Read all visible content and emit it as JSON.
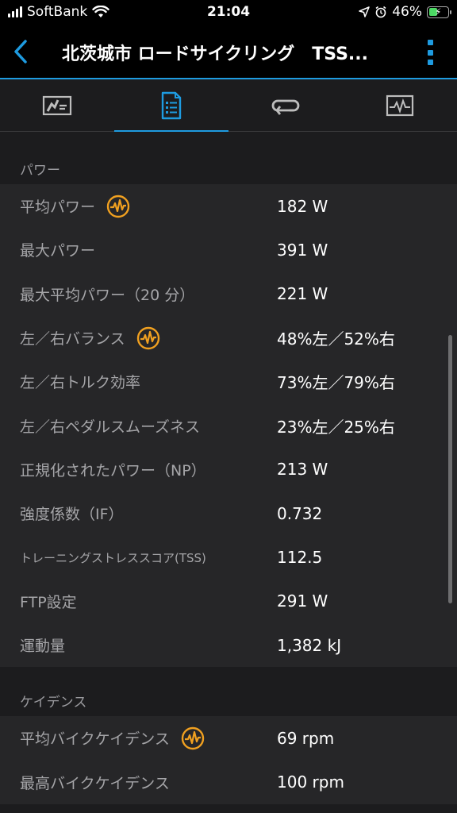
{
  "status_bar": {
    "carrier": "SoftBank",
    "time": "21:04",
    "battery_percent": "46%",
    "battery_level": 0.46
  },
  "header": {
    "title": "北茨城市 ロードサイクリング　TSS...",
    "accent_color": "#1e9be0"
  },
  "tabs": [
    {
      "icon": "speed-chart-icon",
      "active": false
    },
    {
      "icon": "document-list-icon",
      "active": true
    },
    {
      "icon": "loop-icon",
      "active": false
    },
    {
      "icon": "activity-graph-icon",
      "active": false
    }
  ],
  "sections": {
    "power": {
      "title": "パワー",
      "rows": [
        {
          "label": "平均パワー",
          "value": "182 W",
          "has_icon": true
        },
        {
          "label": "最大パワー",
          "value": "391 W"
        },
        {
          "label": "最大平均パワー（20 分）",
          "value": "221 W"
        },
        {
          "label": "左／右バランス",
          "value": "48%左／52%右",
          "has_icon": true
        },
        {
          "label": "左／右トルク効率",
          "value": "73%左／79%右"
        },
        {
          "label": "左／右ペダルスムーズネス",
          "value": "23%左／25%右"
        },
        {
          "label": "正規化されたパワー（NP）",
          "value": "213 W"
        },
        {
          "label": "強度係数（IF）",
          "value": "0.732"
        },
        {
          "label": "トレーニングストレススコア(TSS)",
          "value": "112.5"
        },
        {
          "label": "FTP設定",
          "value": "291 W"
        },
        {
          "label": "運動量",
          "value": "1,382 kJ"
        }
      ]
    },
    "cadence": {
      "title": "ケイデンス",
      "rows": [
        {
          "label": "平均バイクケイデンス",
          "value": "69 rpm",
          "has_icon": true
        },
        {
          "label": "最高バイクケイデンス",
          "value": "100 rpm"
        }
      ]
    }
  },
  "colors": {
    "icon_orange": "#f0a020",
    "background": "#1c1c1e",
    "row_background": "#262628"
  }
}
